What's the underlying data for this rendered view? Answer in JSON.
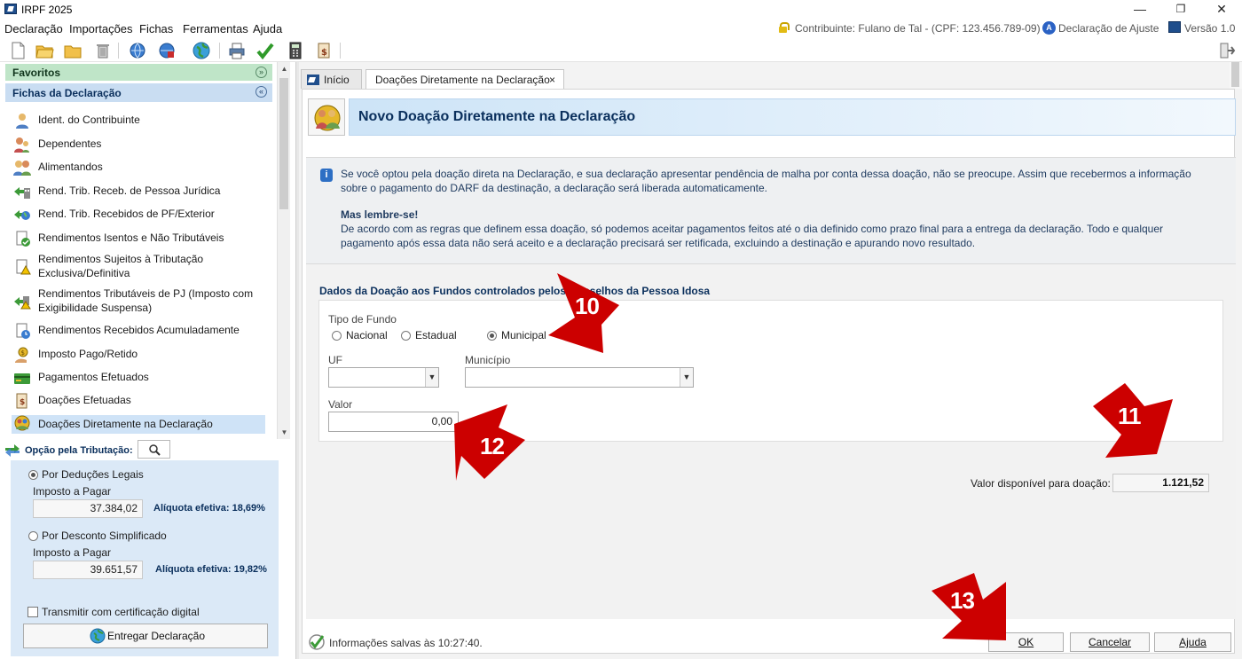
{
  "window": {
    "title": "IRPF 2025",
    "minimize": "—",
    "maximize": "❐",
    "close": "✕"
  },
  "menu": {
    "items": [
      "Declaração",
      "Importações",
      "Fichas",
      "Ferramentas",
      "Ajuda"
    ],
    "contribuinte": "Contribuinte: Fulano de Tal - (CPF: 123.456.789-09)",
    "tipo": "Declaração de Ajuste",
    "versao": "Versão 1.0"
  },
  "sidebar": {
    "favoritos": "Favoritos",
    "fichas_header": "Fichas da Declaração",
    "items": [
      {
        "label": "Ident. do Contribuinte",
        "icon": "person-icon"
      },
      {
        "label": "Dependentes",
        "icon": "family-icon"
      },
      {
        "label": "Alimentandos",
        "icon": "people-icon"
      },
      {
        "label": "Rend. Trib. Receb. de Pessoa Jurídica",
        "icon": "money-company-icon"
      },
      {
        "label": "Rend. Trib. Recebidos de PF/Exterior",
        "icon": "money-globe-icon"
      },
      {
        "label": "Rendimentos Isentos e Não Tributáveis",
        "icon": "document-check-icon"
      },
      {
        "label": "Rendimentos Sujeitos à Tributação Exclusiva/Definitiva",
        "icon": "document-warning-icon"
      },
      {
        "label": "Rendimentos Tributáveis de PJ (Imposto com Exigibilidade Suspensa)",
        "icon": "money-warning-icon"
      },
      {
        "label": "Rendimentos Recebidos Acumuladamente",
        "icon": "document-clock-icon"
      },
      {
        "label": "Imposto Pago/Retido",
        "icon": "coin-hand-icon"
      },
      {
        "label": "Pagamentos Efetuados",
        "icon": "card-icon"
      },
      {
        "label": "Doações Efetuadas",
        "icon": "document-money-icon"
      },
      {
        "label": "Doações Diretamente na Declaração",
        "icon": "donation-people-icon"
      }
    ],
    "opcao_label": "Opção pela Tributação:",
    "deducoes": {
      "label": "Por Deduções Legais",
      "imposto_label": "Imposto a Pagar",
      "imposto_value": "37.384,02",
      "aliquota": "Alíquota efetiva: 18,69%"
    },
    "simplificado": {
      "label": "Por Desconto Simplificado",
      "imposto_label": "Imposto a Pagar",
      "imposto_value": "39.651,57",
      "aliquota": "Alíquota efetiva: 19,82%"
    },
    "certificacao": "Transmitir com certificação digital",
    "entregar": "Entregar Declaração"
  },
  "tabs": {
    "inicio": "Início",
    "doacoes": "Doações Diretamente na Declaração",
    "close": "×"
  },
  "form": {
    "title": "Novo Doação Diretamente na Declaração",
    "info_p1": "Se você optou pela doação direta na Declaração, e sua declaração apresentar pendência de malha por conta dessa doação, não se preocupe. Assim que recebermos a informação sobre o pagamento do DARF da destinação, a declaração será liberada automaticamente.",
    "info_bold": "Mas lembre-se!",
    "info_p2": "De acordo com as regras que definem essa doação, só podemos aceitar pagamentos feitos até o dia definido como prazo final para a entrega da declaração. Todo e qualquer pagamento após essa data não será aceito e a declaração precisará ser retificada, excluindo a destinação e apurando novo resultado.",
    "section_title": "Dados da Doação aos Fundos controlados pelos Conselhos da Pessoa Idosa",
    "tipo_fundo": "Tipo de Fundo",
    "opt_nacional": "Nacional",
    "opt_estadual": "Estadual",
    "opt_municipal": "Municipal",
    "uf": "UF",
    "municipio": "Município",
    "valor": "Valor",
    "valor_value": "0,00",
    "disponivel_label": "Valor disponível para doação:",
    "disponivel_value": "1.121,52",
    "status": "Informações salvas às 10:27:40.",
    "ok": "OK",
    "cancelar": "Cancelar",
    "ajuda": "Ajuda"
  },
  "annotations": {
    "n10": "10",
    "n11": "11",
    "n12": "12",
    "n13": "13",
    "color": "#cc0000"
  }
}
